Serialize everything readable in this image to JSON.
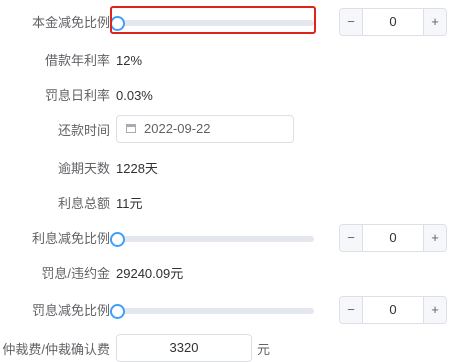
{
  "form": {
    "principal_ratio": {
      "label": "本金减免比例",
      "slider_level": 0,
      "stepper_value": "0",
      "dec": "−",
      "inc": "+"
    },
    "loan_annual_rate": {
      "label": "借款年利率",
      "value": "12%"
    },
    "penalty_daily_rate": {
      "label": "罚息日利率",
      "value": "0.03%"
    },
    "repayment_time": {
      "label": "还款时间",
      "value": "2022-09-22",
      "icon": "calendar-icon"
    },
    "overdue_days": {
      "label": "逾期天数",
      "value": "1228天"
    },
    "interest_total": {
      "label": "利息总额",
      "value": "11元"
    },
    "interest_ratio": {
      "label": "利息减免比例",
      "slider_level": 0,
      "stepper_value": "0",
      "dec": "−",
      "inc": "+"
    },
    "penalty_amount": {
      "label": "罚息/违约金",
      "value": "29240.09元"
    },
    "penalty_ratio": {
      "label": "罚息减免比例",
      "slider_level": 0,
      "stepper_value": "0",
      "dec": "−",
      "inc": "+"
    },
    "arbitration_fee": {
      "label": "仲裁费/仲裁确认费",
      "value": "3320",
      "suffix": "元"
    }
  },
  "colors": {
    "accent": "#409eff",
    "highlight": "#e0231a",
    "track": "#e4e7ed"
  }
}
